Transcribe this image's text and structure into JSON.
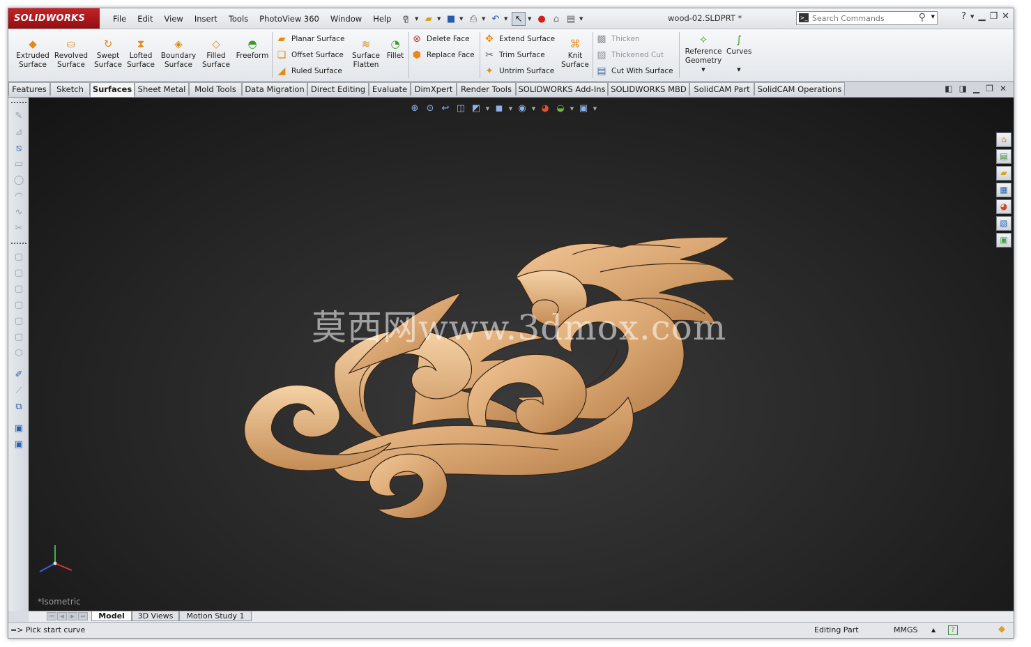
{
  "app": {
    "name": "SOLIDWORKS",
    "document_title": "wood-02.SLDPRT *"
  },
  "menu": [
    "File",
    "Edit",
    "View",
    "Insert",
    "Tools",
    "PhotoView 360",
    "Window",
    "Help"
  ],
  "search": {
    "placeholder": "Search Commands"
  },
  "toolbar": {
    "extruded_surface": "Extruded Surface",
    "revolved_surface": "Revolved Surface",
    "swept_surface": "Swept Surface",
    "lofted_surface": "Lofted Surface",
    "boundary_surface": "Boundary Surface",
    "filled_surface": "Filled Surface",
    "freeform": "Freeform",
    "planar_surface": "Planar Surface",
    "offset_surface": "Offset Surface",
    "ruled_surface": "Ruled Surface",
    "surface_flatten": "Surface Flatten",
    "fillet": "Fillet",
    "delete_face": "Delete Face",
    "replace_face": "Replace Face",
    "extend_surface": "Extend Surface",
    "trim_surface": "Trim Surface",
    "untrim_surface": "Untrim Surface",
    "knit_surface": "Knit Surface",
    "thicken": "Thicken",
    "thickened_cut": "Thickened Cut",
    "cut_with_surface": "Cut With Surface",
    "reference_geometry": "Reference Geometry",
    "curves": "Curves"
  },
  "tabs": [
    "Features",
    "Sketch",
    "Surfaces",
    "Sheet Metal",
    "Mold Tools",
    "Data Migration",
    "Direct Editing",
    "Evaluate",
    "DimXpert",
    "Render Tools",
    "SOLIDWORKS Add-Ins",
    "SOLIDWORKS MBD",
    "SolidCAM Part",
    "SolidCAM Operations"
  ],
  "active_tab": "Surfaces",
  "viewport": {
    "watermark": "莫西网www.3dmox.com",
    "view_orientation": "*Isometric"
  },
  "bottom_tabs": [
    "Model",
    "3D Views",
    "Motion Study 1"
  ],
  "status": {
    "prompt": "=> Pick start curve",
    "mode": "Editing Part",
    "units": "MMGS"
  },
  "colors": {
    "brand_red": "#c62126",
    "wood": "#d9a672",
    "background": "#262626"
  }
}
